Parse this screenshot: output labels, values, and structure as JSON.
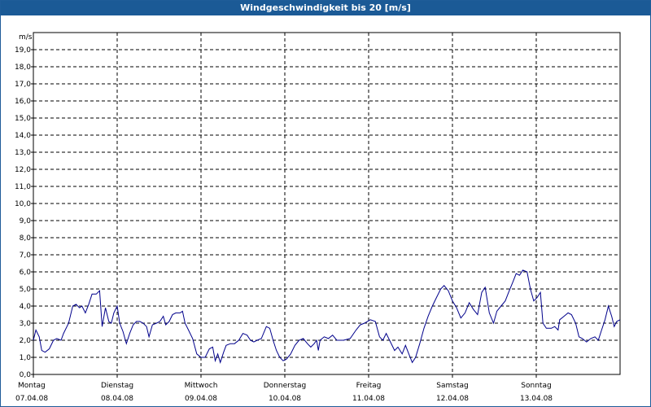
{
  "window": {
    "title": "Windgeschwindigkeit bis 20 [m/s]"
  },
  "chart_data": {
    "type": "line",
    "title": "Windgeschwindigkeit bis 20 [m/s]",
    "ylabel": "m/s",
    "xlabel": "",
    "ylim": [
      0,
      20
    ],
    "yticks": [
      "0,0",
      "1,0",
      "2,0",
      "3,0",
      "4,0",
      "5,0",
      "6,0",
      "7,0",
      "8,0",
      "9,0",
      "10,0",
      "11,0",
      "12,0",
      "13,0",
      "14,0",
      "15,0",
      "16,0",
      "17,0",
      "18,0",
      "19,0"
    ],
    "xlim_days": [
      0,
      7
    ],
    "days": [
      {
        "name": "Montag",
        "date": "07.04.08"
      },
      {
        "name": "Dienstag",
        "date": "08.04.08"
      },
      {
        "name": "Mittwoch",
        "date": "09.04.08"
      },
      {
        "name": "Donnerstag",
        "date": "10.04.08"
      },
      {
        "name": "Freitag",
        "date": "11.04.08"
      },
      {
        "name": "Samstag",
        "date": "12.04.08"
      },
      {
        "name": "Sonntag",
        "date": "13.04.08"
      }
    ],
    "grid": true,
    "line_color": "#00008b",
    "series": [
      {
        "values": [
          [
            0.0,
            2.0
          ],
          [
            0.03,
            2.6
          ],
          [
            0.07,
            2.2
          ],
          [
            0.1,
            1.4
          ],
          [
            0.14,
            1.3
          ],
          [
            0.19,
            1.5
          ],
          [
            0.24,
            2.0
          ],
          [
            0.28,
            2.1
          ],
          [
            0.33,
            2.0
          ],
          [
            0.36,
            2.4
          ],
          [
            0.42,
            3.0
          ],
          [
            0.47,
            4.0
          ],
          [
            0.51,
            4.1
          ],
          [
            0.55,
            3.9
          ],
          [
            0.58,
            4.0
          ],
          [
            0.62,
            3.6
          ],
          [
            0.66,
            4.1
          ],
          [
            0.7,
            4.7
          ],
          [
            0.75,
            4.7
          ],
          [
            0.79,
            4.9
          ],
          [
            0.82,
            2.8
          ],
          [
            0.86,
            3.9
          ],
          [
            0.9,
            3.1
          ],
          [
            0.93,
            3.0
          ],
          [
            0.96,
            3.6
          ],
          [
            1.0,
            4.0
          ],
          [
            1.03,
            3.0
          ],
          [
            1.07,
            2.5
          ],
          [
            1.11,
            1.8
          ],
          [
            1.15,
            2.4
          ],
          [
            1.19,
            2.9
          ],
          [
            1.23,
            3.1
          ],
          [
            1.27,
            3.1
          ],
          [
            1.31,
            3.0
          ],
          [
            1.35,
            2.8
          ],
          [
            1.38,
            2.2
          ],
          [
            1.42,
            2.9
          ],
          [
            1.47,
            3.0
          ],
          [
            1.51,
            3.1
          ],
          [
            1.55,
            3.4
          ],
          [
            1.58,
            2.9
          ],
          [
            1.62,
            3.1
          ],
          [
            1.66,
            3.5
          ],
          [
            1.7,
            3.6
          ],
          [
            1.75,
            3.6
          ],
          [
            1.78,
            3.7
          ],
          [
            1.81,
            3.0
          ],
          [
            1.85,
            2.6
          ],
          [
            1.9,
            2.1
          ],
          [
            1.95,
            1.2
          ],
          [
            2.0,
            1.0
          ],
          [
            2.05,
            1.0
          ],
          [
            2.1,
            1.5
          ],
          [
            2.14,
            1.6
          ],
          [
            2.17,
            0.8
          ],
          [
            2.2,
            1.2
          ],
          [
            2.23,
            0.7
          ],
          [
            2.27,
            1.3
          ],
          [
            2.3,
            1.7
          ],
          [
            2.35,
            1.8
          ],
          [
            2.4,
            1.8
          ],
          [
            2.45,
            2.0
          ],
          [
            2.5,
            2.4
          ],
          [
            2.55,
            2.3
          ],
          [
            2.59,
            2.0
          ],
          [
            2.63,
            1.9
          ],
          [
            2.67,
            2.0
          ],
          [
            2.72,
            2.1
          ],
          [
            2.78,
            2.8
          ],
          [
            2.82,
            2.7
          ],
          [
            2.86,
            2.0
          ],
          [
            2.9,
            1.4
          ],
          [
            2.94,
            1.0
          ],
          [
            2.98,
            0.8
          ],
          [
            3.02,
            0.9
          ],
          [
            3.07,
            1.2
          ],
          [
            3.12,
            1.7
          ],
          [
            3.17,
            2.0
          ],
          [
            3.22,
            2.1
          ],
          [
            3.27,
            1.8
          ],
          [
            3.31,
            1.6
          ],
          [
            3.35,
            1.8
          ],
          [
            3.38,
            2.0
          ],
          [
            3.4,
            1.4
          ],
          [
            3.42,
            2.0
          ],
          [
            3.47,
            2.2
          ],
          [
            3.52,
            2.1
          ],
          [
            3.57,
            2.3
          ],
          [
            3.62,
            2.0
          ],
          [
            3.7,
            2.0
          ],
          [
            3.78,
            2.1
          ],
          [
            3.85,
            2.6
          ],
          [
            3.9,
            2.9
          ],
          [
            3.95,
            3.0
          ],
          [
            4.02,
            3.2
          ],
          [
            4.08,
            3.1
          ],
          [
            4.13,
            2.2
          ],
          [
            4.17,
            2.0
          ],
          [
            4.21,
            2.4
          ],
          [
            4.26,
            1.9
          ],
          [
            4.31,
            1.4
          ],
          [
            4.35,
            1.6
          ],
          [
            4.4,
            1.2
          ],
          [
            4.44,
            1.7
          ],
          [
            4.48,
            1.2
          ],
          [
            4.52,
            0.7
          ],
          [
            4.56,
            1.0
          ],
          [
            4.61,
            1.8
          ],
          [
            4.66,
            2.7
          ],
          [
            4.71,
            3.4
          ],
          [
            4.76,
            4.0
          ],
          [
            4.81,
            4.5
          ],
          [
            4.86,
            5.0
          ],
          [
            4.9,
            5.2
          ],
          [
            4.95,
            4.9
          ],
          [
            5.0,
            4.3
          ],
          [
            5.05,
            3.9
          ],
          [
            5.1,
            3.3
          ],
          [
            5.15,
            3.6
          ],
          [
            5.2,
            4.2
          ],
          [
            5.25,
            3.8
          ],
          [
            5.3,
            3.5
          ],
          [
            5.35,
            4.8
          ],
          [
            5.39,
            5.1
          ],
          [
            5.44,
            3.6
          ],
          [
            5.49,
            3.0
          ],
          [
            5.53,
            3.7
          ],
          [
            5.58,
            4.0
          ],
          [
            5.63,
            4.3
          ],
          [
            5.67,
            4.8
          ],
          [
            5.72,
            5.4
          ],
          [
            5.76,
            5.9
          ],
          [
            5.8,
            5.8
          ],
          [
            5.84,
            6.1
          ],
          [
            5.89,
            6.0
          ],
          [
            5.93,
            5.0
          ],
          [
            5.97,
            4.3
          ],
          [
            6.01,
            4.5
          ],
          [
            6.05,
            4.8
          ],
          [
            6.08,
            3.0
          ],
          [
            6.12,
            2.7
          ],
          [
            6.18,
            2.7
          ],
          [
            6.22,
            2.8
          ],
          [
            6.26,
            2.6
          ],
          [
            6.28,
            3.2
          ],
          [
            6.33,
            3.4
          ],
          [
            6.38,
            3.6
          ],
          [
            6.42,
            3.5
          ],
          [
            6.47,
            3.0
          ],
          [
            6.51,
            2.2
          ],
          [
            6.55,
            2.1
          ],
          [
            6.6,
            1.9
          ],
          [
            6.65,
            2.1
          ],
          [
            6.7,
            2.2
          ],
          [
            6.74,
            2.0
          ],
          [
            6.78,
            2.6
          ],
          [
            6.82,
            3.2
          ],
          [
            6.86,
            4.0
          ],
          [
            6.9,
            3.4
          ],
          [
            6.93,
            2.8
          ],
          [
            6.96,
            3.1
          ],
          [
            7.0,
            3.2
          ]
        ]
      }
    ]
  }
}
